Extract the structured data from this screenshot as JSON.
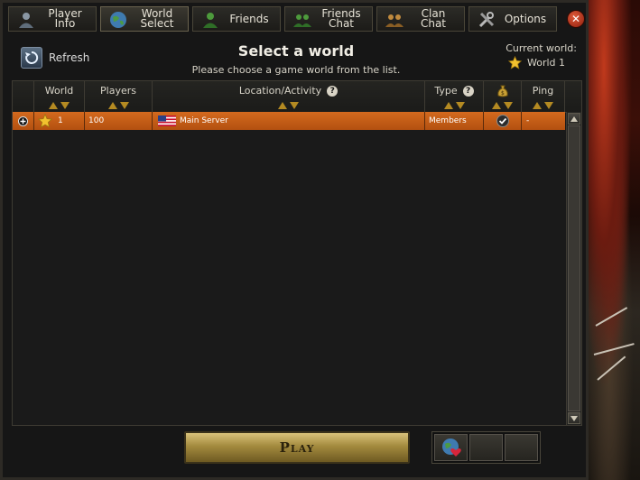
{
  "tabs": [
    {
      "label": "Player\nInfo",
      "icon": "player-info-icon"
    },
    {
      "label": "World\nSelect",
      "icon": "globe-icon"
    },
    {
      "label": "Friends",
      "icon": "friends-icon"
    },
    {
      "label": "Friends\nChat",
      "icon": "friends-chat-icon"
    },
    {
      "label": "Clan\nChat",
      "icon": "clan-chat-icon"
    },
    {
      "label": "Options",
      "icon": "tools-icon"
    }
  ],
  "active_tab": "World\nSelect",
  "header": {
    "refresh_label": "Refresh",
    "title": "Select a world",
    "subtitle": "Please choose a game world from the list.",
    "current_world_label": "Current world:",
    "current_world_value": "World 1"
  },
  "table": {
    "columns": [
      "World",
      "Players",
      "Location/Activity",
      "Type",
      "",
      "Ping"
    ],
    "rows": [
      {
        "world": "1",
        "players": "100",
        "location": "Main Server",
        "type": "Members",
        "ping": "-"
      }
    ]
  },
  "play_label": "Play",
  "colors": {
    "accent": "#c95d16",
    "gold": "#b48a22",
    "panel": "#161616"
  }
}
